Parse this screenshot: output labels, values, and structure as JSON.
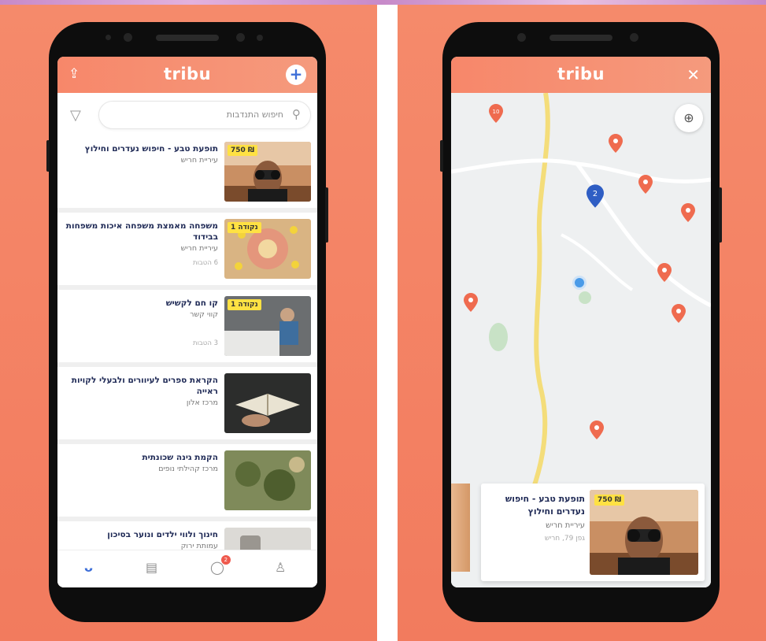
{
  "brand": "tribu",
  "colors": {
    "accent": "#f7876a",
    "primary": "#3d6fd8",
    "price_tag": "#ffe143",
    "title": "#1f2a56",
    "pin": "#ef6b4f"
  },
  "list_screen": {
    "header": {
      "left_icon": "share-icon",
      "right_icon": "plus-icon",
      "plus": "+"
    },
    "search_placeholder": "חיפוש התנדבות",
    "cards": [
      {
        "title": "תופעת טבע - חיפוש נעדרים וחילוץ",
        "subtitle": "עיריית חריש",
        "meta": "",
        "price": "750 ₪"
      },
      {
        "title": "משפחה מאמצת משפחה איכות משפחות בבידוד",
        "subtitle": "עיריית חריש",
        "meta": "6 הטבות",
        "price": "1 נקודה"
      },
      {
        "title": "קו חם לקשיש",
        "subtitle": "קווי קשר",
        "meta": "3 הטבות",
        "price": "1 נקודה"
      },
      {
        "title": "הקראת ספרים לעיוורים ולבעלי לקויות ראייה",
        "subtitle": "מרכז אלון",
        "meta": "",
        "price": ""
      },
      {
        "title": "הקמת גינה שכונתית",
        "subtitle": "מרכז קהילתי נופים",
        "meta": "",
        "price": ""
      },
      {
        "title": "חינוך ולווי ילדים ונוער בסיכון",
        "subtitle": "עמותת ירוק",
        "meta": "",
        "price": ""
      }
    ],
    "tabs": [
      {
        "icon": "smile-icon",
        "glyph": "ᴗ"
      },
      {
        "icon": "book-icon",
        "glyph": "▤"
      },
      {
        "icon": "chat-icon",
        "glyph": "◯",
        "badge": "2"
      },
      {
        "icon": "user-icon",
        "glyph": "♙"
      }
    ]
  },
  "map_screen": {
    "header": {
      "close": "✕"
    },
    "cluster_count": "2",
    "pins": [
      {
        "label": "10"
      }
    ],
    "locate_glyph": "⊕",
    "card": {
      "title": "תופעת טבע - חיפוש נעדרים וחילוץ",
      "subtitle": "עיריית חריש",
      "meta": "גפן 79, חריש",
      "price": "750 ₪"
    }
  }
}
